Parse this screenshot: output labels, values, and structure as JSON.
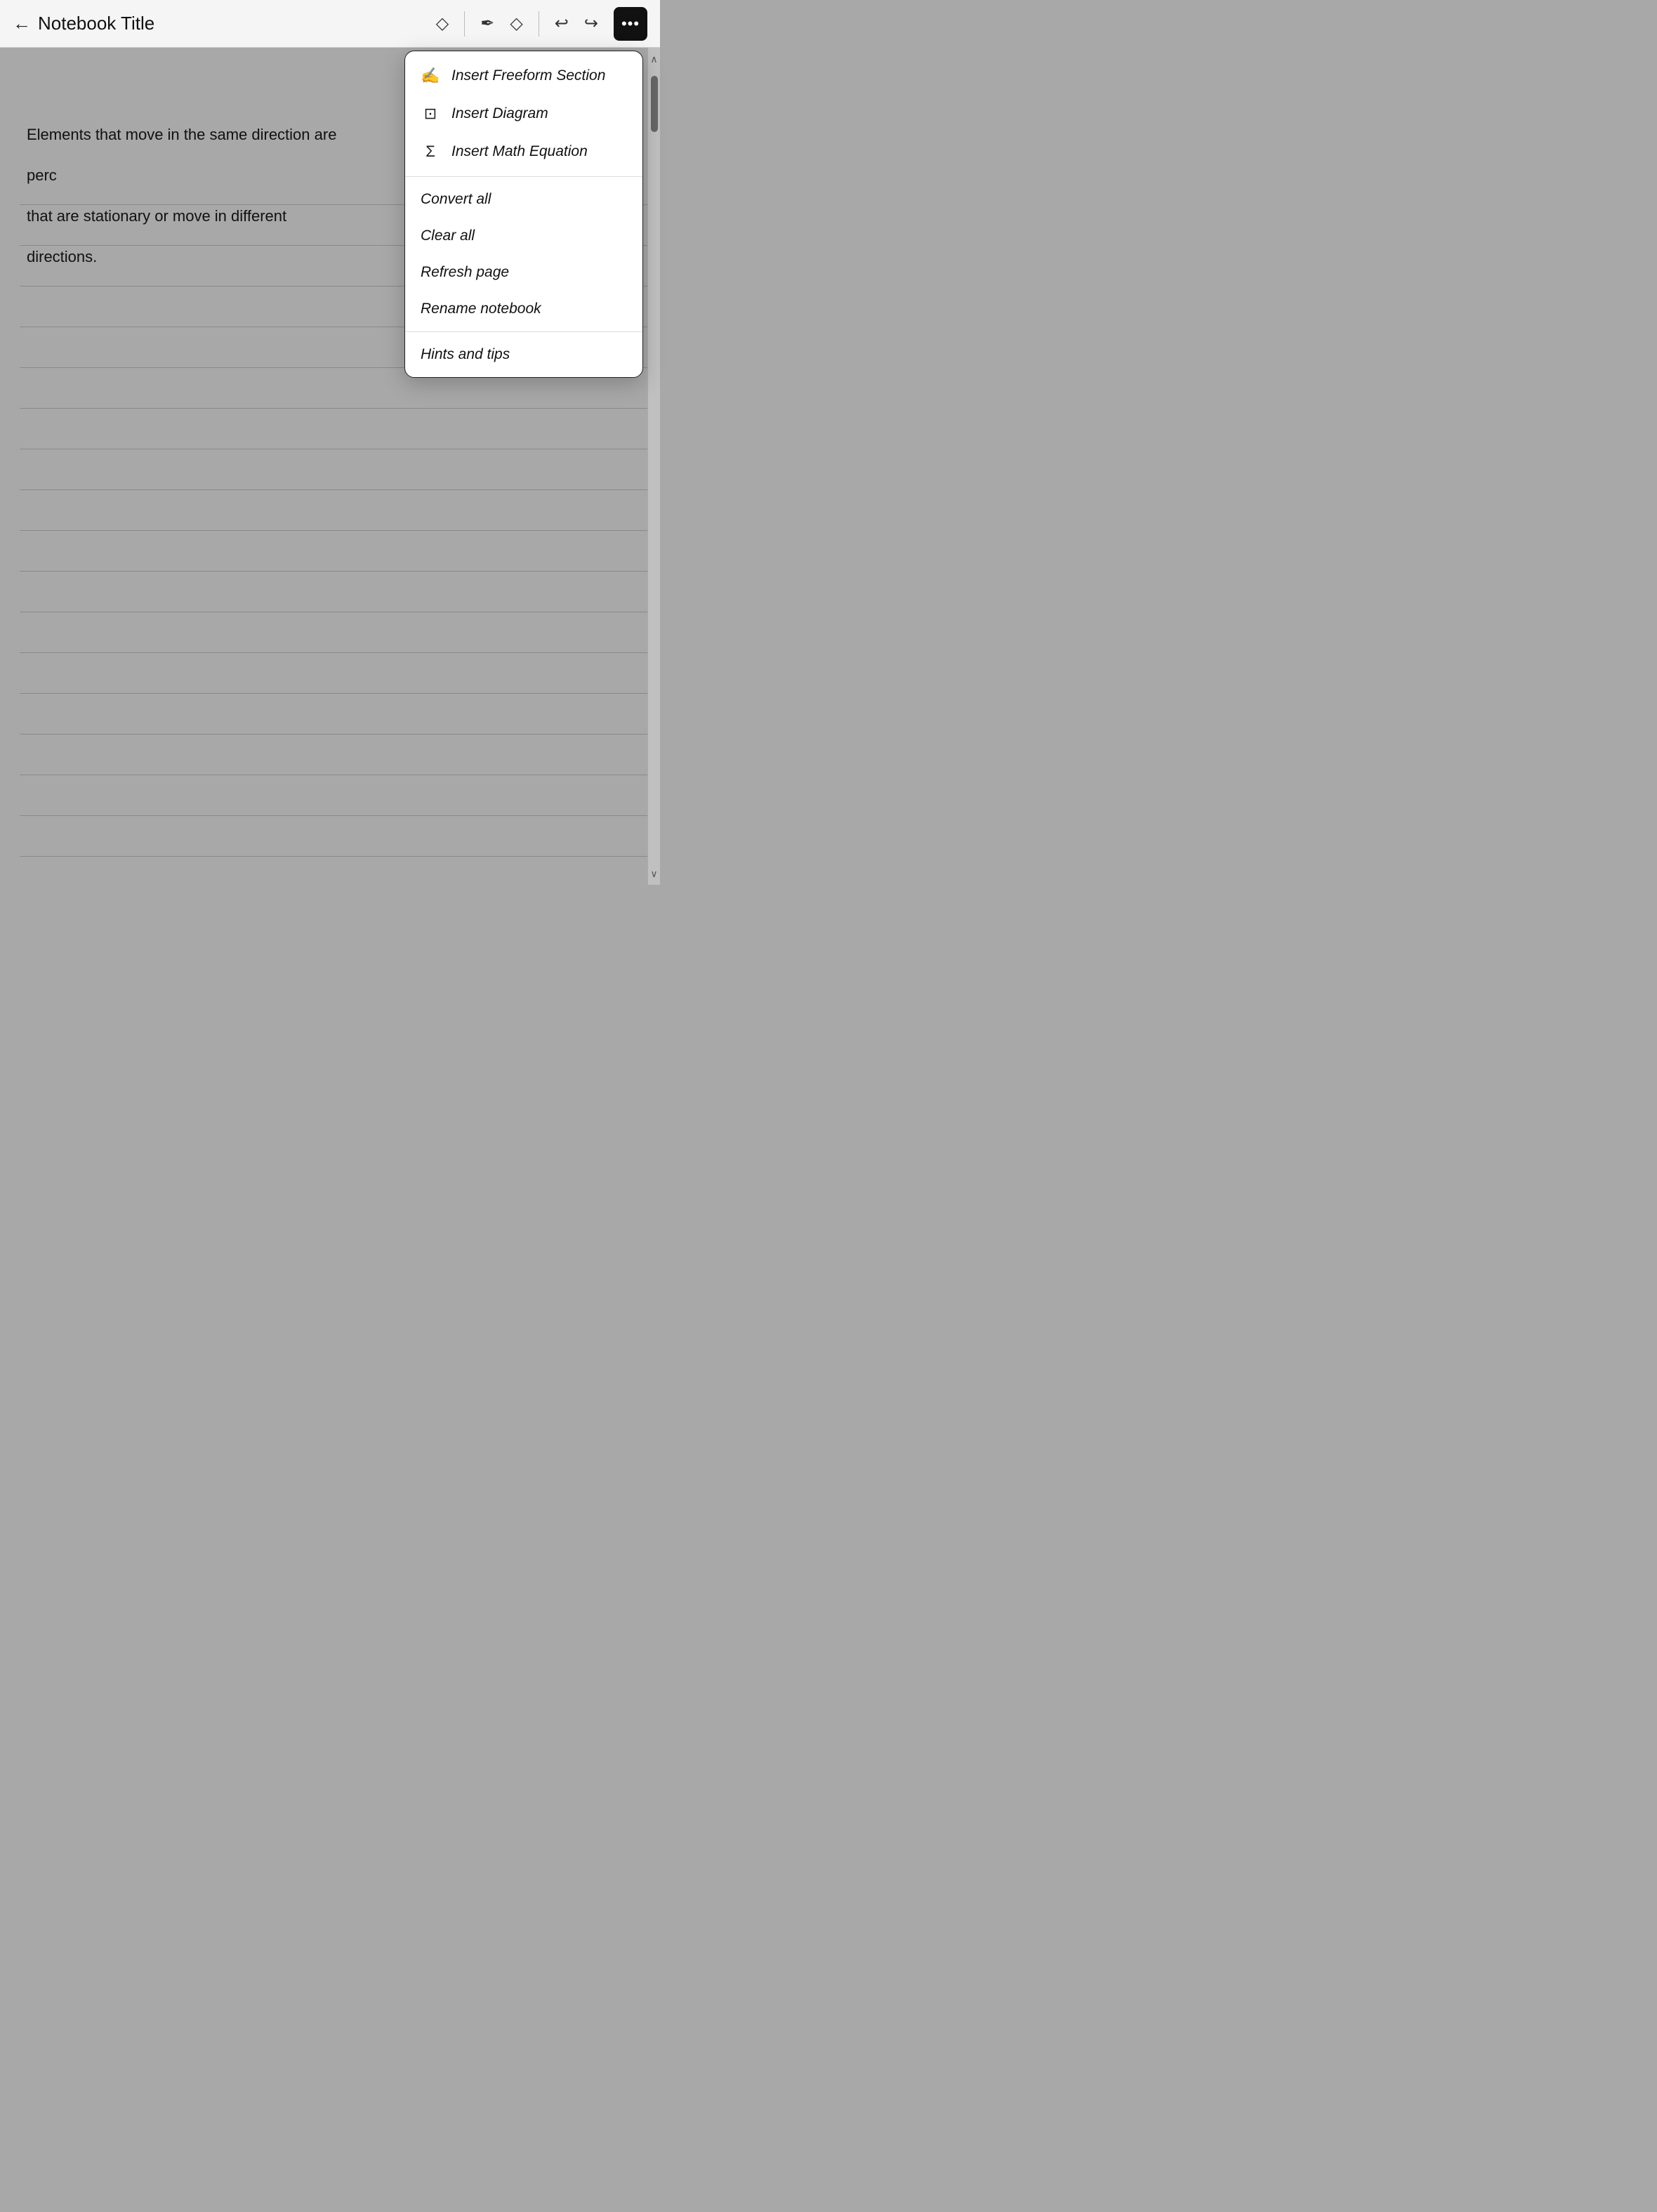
{
  "header": {
    "back_label": "←",
    "title": "Notebook Title",
    "more_button_label": "•••"
  },
  "notebook": {
    "text_line1": "Elements that move in the same direction are perc",
    "text_line2": "that are stationary or move in different directions."
  },
  "dropdown": {
    "section1": [
      {
        "id": "freeform",
        "icon": "✍",
        "label": "Insert Freeform Section"
      },
      {
        "id": "diagram",
        "icon": "⊡",
        "label": "Insert Diagram"
      },
      {
        "id": "equation",
        "icon": "Σ",
        "label": "Insert Math Equation"
      }
    ],
    "section2": [
      {
        "id": "convert",
        "label": "Convert all"
      },
      {
        "id": "clear",
        "label": "Clear all"
      },
      {
        "id": "refresh",
        "label": "Refresh page"
      },
      {
        "id": "rename",
        "label": "Rename notebook"
      }
    ],
    "section3": [
      {
        "id": "hints",
        "label": "Hints and tips"
      }
    ]
  },
  "scrollbar": {
    "up_arrow": "∧",
    "down_arrow": "∨"
  }
}
